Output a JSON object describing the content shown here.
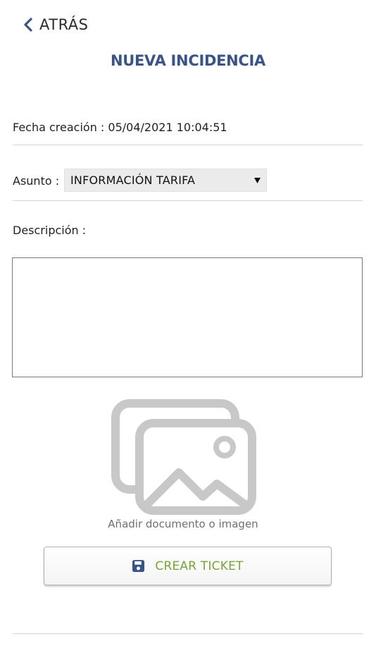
{
  "header": {
    "back_label": "ATRÁS",
    "title": "NUEVA INCIDENCIA"
  },
  "form": {
    "fecha": "Fecha creación : 05/04/2021 10:04:51",
    "asunto_label": "Asunto :",
    "asunto_value": "INFORMACIÓN TARIFA",
    "descripcion_label": "Descripción :",
    "descripcion_value": ""
  },
  "upload": {
    "caption": "Añadir documento o imagen",
    "icon": "image-gallery-icon"
  },
  "actions": {
    "create_label": "CREAR TICKET",
    "create_icon": "save-icon"
  },
  "colors": {
    "title": "#3a5486",
    "button_text": "#7aa33a",
    "save_icon": "#3a5486",
    "upload_icon": "#c8c8c8"
  }
}
